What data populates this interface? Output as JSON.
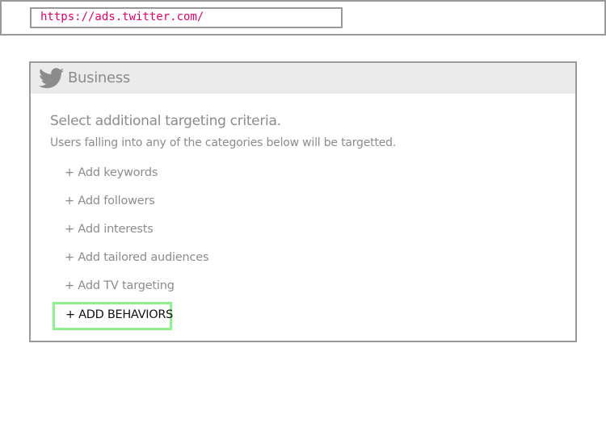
{
  "browser": {
    "url": "https://ads.twitter.com/"
  },
  "header": {
    "brand": "Business",
    "icon": "twitter-bird-icon"
  },
  "targeting": {
    "heading": "Select additional targeting criteria.",
    "subheading": "Users falling into any of the categories below will be targetted.",
    "options": [
      "+ Add keywords",
      "+ Add followers",
      "+ Add interests",
      "+ Add tailored audiences",
      "+ Add TV targeting"
    ],
    "behaviors_button": "+ ADD BEHAVIORS"
  },
  "colors": {
    "url_text": "#e0006a",
    "highlight_border": "#8ef08e",
    "muted_text": "#8c8c8c"
  }
}
